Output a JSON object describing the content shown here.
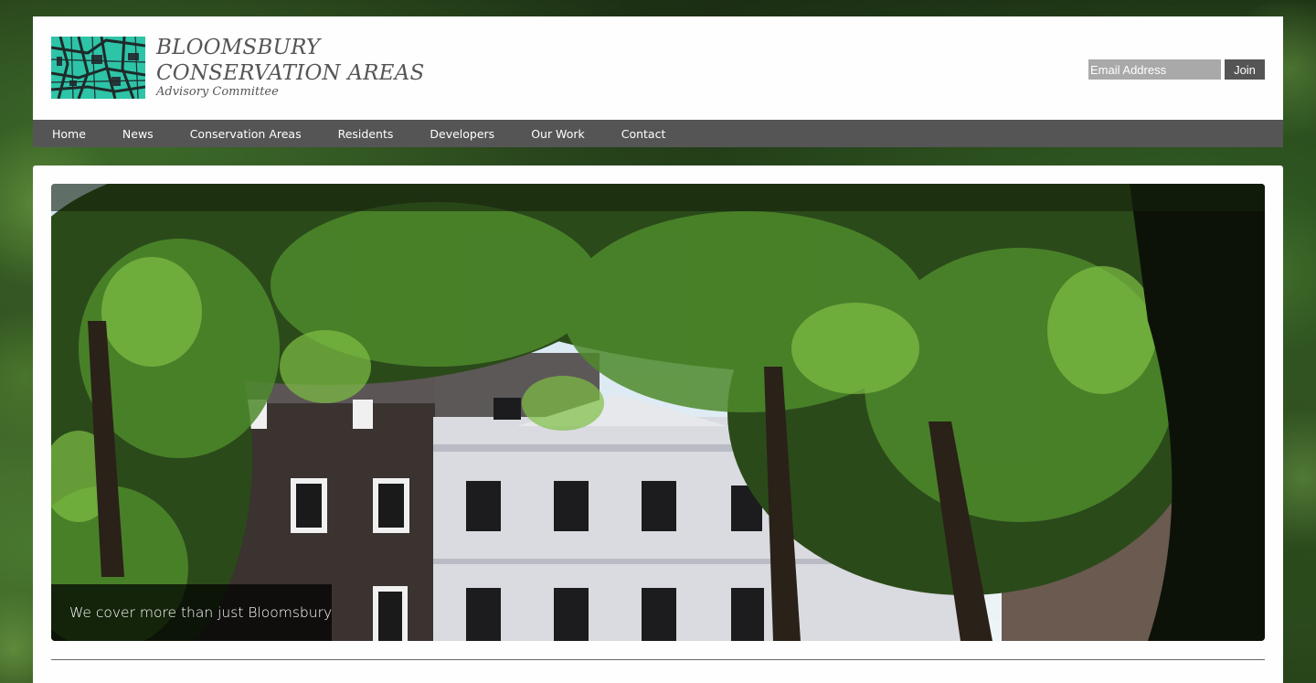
{
  "brand": {
    "title_line1": "BLOOMSBURY",
    "title_line2": "CONSERVATION AREAS",
    "subtitle": "Advisory Committee",
    "logo_icon": "map-logo-icon",
    "accent_color": "#2ec4a8"
  },
  "signup": {
    "email_placeholder": "Email Address",
    "join_label": "Join"
  },
  "nav": {
    "items": [
      {
        "label": "Home"
      },
      {
        "label": "News"
      },
      {
        "label": "Conservation Areas"
      },
      {
        "label": "Residents"
      },
      {
        "label": "Developers"
      },
      {
        "label": "Our Work"
      },
      {
        "label": "Contact"
      }
    ],
    "background_color": "#555555"
  },
  "hero": {
    "caption": "We cover more than just Bloomsbury"
  }
}
